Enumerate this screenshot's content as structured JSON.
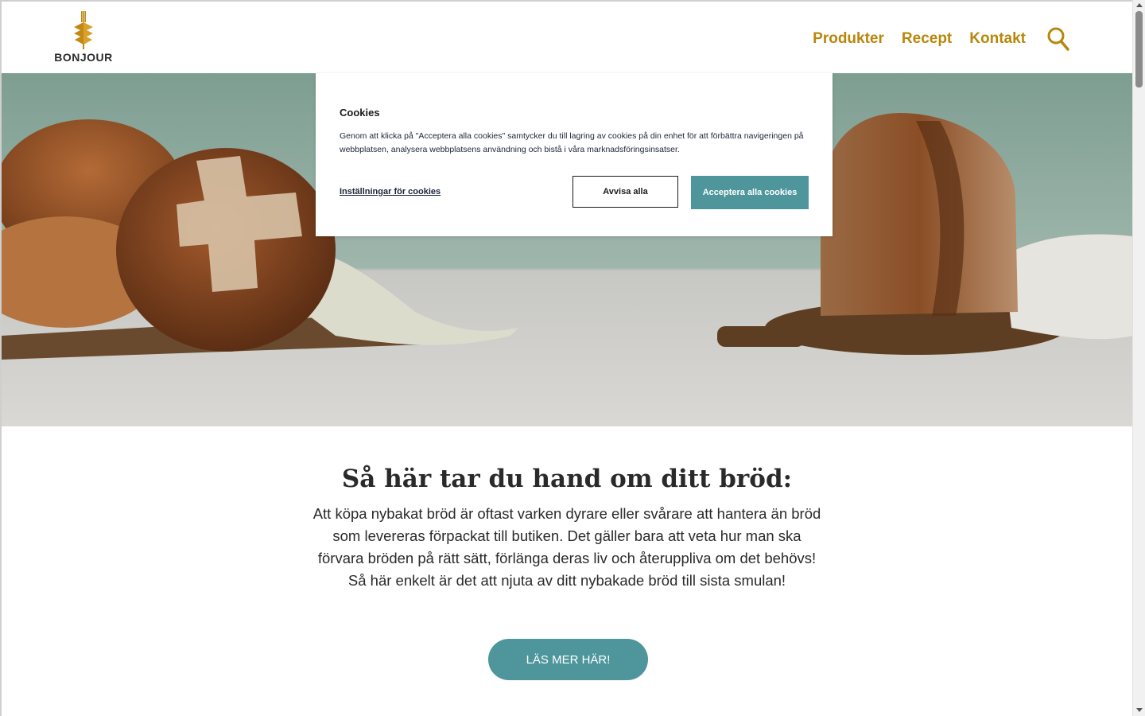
{
  "header": {
    "logo_text": "BONJOUR",
    "nav": [
      {
        "label": "Produkter"
      },
      {
        "label": "Recept"
      },
      {
        "label": "Kontakt"
      }
    ]
  },
  "cookie_dialog": {
    "title": "Cookies",
    "text": "Genom att klicka på \"Acceptera alla cookies\" samtycker du till lagring av cookies på din enhet för att förbättra navigeringen på webbplatsen, analysera webbplatsens användning och bistå i våra marknadsföringsinsatser.",
    "settings_link": "Inställningar för cookies",
    "reject_label": "Avvisa alla",
    "accept_label": "Acceptera alla cookies"
  },
  "main": {
    "heading": "Så här tar du hand om ditt bröd:",
    "lead": "Att köpa nybakat bröd är oftast varken dyrare eller svårare att hantera än bröd som levereras förpackat till butiken. Det gäller bara att veta hur man ska förvara bröden på rätt sätt, förlänga deras liv och återuppliva om det behövs! Så här enkelt är det att njuta av ditt nybakade bröd till sista smulan!",
    "cta_label": "LÄS MER HÄR!"
  },
  "colors": {
    "brand_gold": "#b8860b",
    "accent_teal": "#4e969c",
    "text_dark": "#2a2a2a"
  },
  "icons": [
    "wheat-logo-icon",
    "search-icon",
    "scroll-up-arrow-icon",
    "scroll-down-arrow-icon"
  ]
}
